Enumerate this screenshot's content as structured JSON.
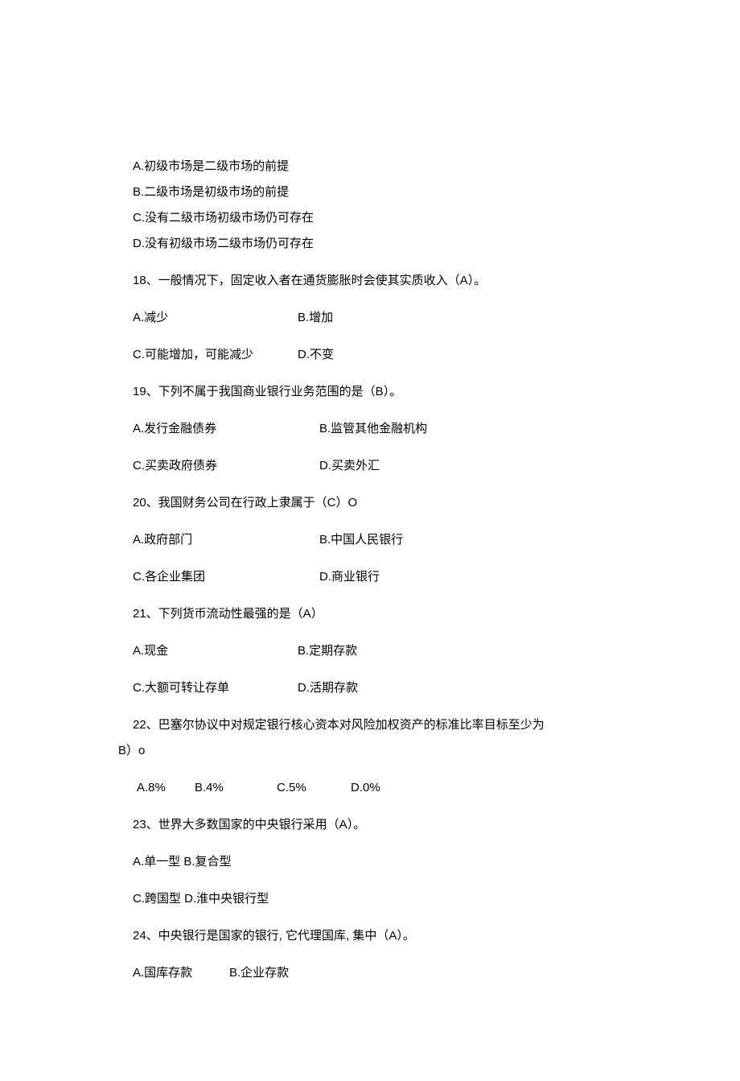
{
  "q17": {
    "optA": "A.初级市场是二级市场的前提",
    "optB": "B.二级市场是初级市场的前提",
    "optC": "C.没有二级市场初级市场仍可存在",
    "optD": "D.没有初级市场二级市场仍可存在"
  },
  "q18": {
    "stem": "18、一般情况下，固定收入者在通货膨胀时会使其实质收入（A）。",
    "optA": "A.减少",
    "optB": "B.增加",
    "optC": "C.可能增加，可能减少",
    "optD": "D.不变"
  },
  "q19": {
    "stem": "19、下列不属于我国商业银行业务范围的是（B）。",
    "optA": "A.发行金融债券",
    "optB": "B.监管其他金融机构",
    "optC": "C.买卖政府债券",
    "optD": "D.买卖外汇"
  },
  "q20": {
    "stem": "20、我国财务公司在行政上隶属于（C）O",
    "optA": "A.政府部门",
    "optB": "B.中国人民银行",
    "optC": "C.各企业集团",
    "optD": "D.商业银行"
  },
  "q21": {
    "stem": "21、下列货币流动性最强的是（A）",
    "optA": "A.现金",
    "optB": "B.定期存款",
    "optC": "C.大额可转让存单",
    "optD": "D.活期存款"
  },
  "q22": {
    "stem_line1": " 22、巴塞尔协议中对规定银行核心资本对风险加权资产的标准比率目标至少为",
    "stem_line2": "B）o",
    "optA": "A.8%",
    "optB": "B.4%",
    "optC": "C.5%",
    "optD": "D.0%"
  },
  "q23": {
    "stem": "23、世界大多数国家的中央银行采用（A）。",
    "optsAB": "A.单一型 B.复合型",
    "optsCD": "C.跨国型 D.淮中央银行型"
  },
  "q24": {
    "stem": "24、中央银行是国家的银行, 它代理国库, 集中（A）。",
    "optA": "A.国库存款",
    "optB": "B.企业存款"
  }
}
